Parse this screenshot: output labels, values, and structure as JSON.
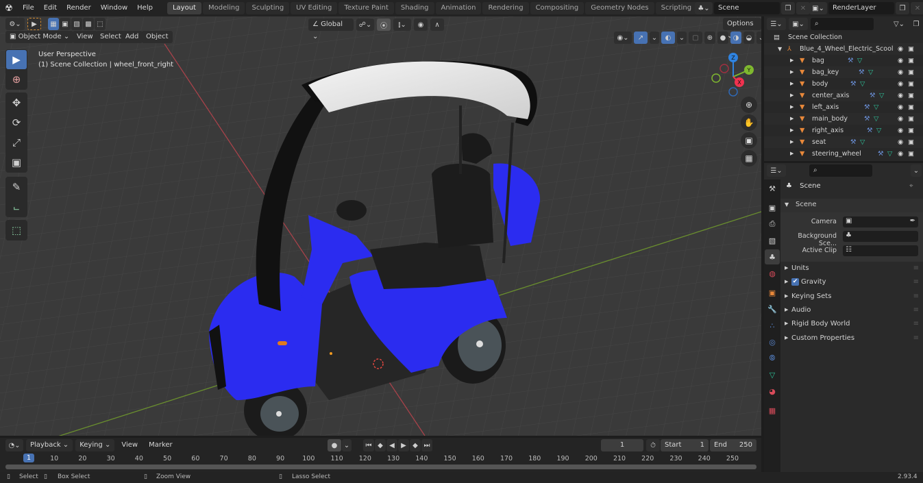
{
  "menubar": {
    "items": [
      "File",
      "Edit",
      "Render",
      "Window",
      "Help"
    ],
    "workspace_tabs": [
      "Layout",
      "Modeling",
      "Sculpting",
      "UV Editing",
      "Texture Paint",
      "Shading",
      "Animation",
      "Rendering",
      "Compositing",
      "Geometry Nodes",
      "Scripting"
    ],
    "active_tab": "Layout",
    "add_tab": "+",
    "scene_name": "Scene",
    "view_layer": "RenderLayer"
  },
  "viewport_header": {
    "mode": "Object Mode",
    "menus": [
      "View",
      "Select",
      "Add",
      "Object"
    ],
    "transform_orientation": "Global",
    "options_label": "Options"
  },
  "viewport": {
    "perspective_label": "User Perspective",
    "context_label": "(1) Scene Collection | wheel_front_right",
    "gizmo_axes": {
      "x": "X",
      "y": "Y",
      "z": "Z"
    },
    "colors": {
      "x_axis": "#f0324f",
      "y_axis": "#7fb82f",
      "z_axis": "#2f83e0",
      "model_blue": "#2b2cf0",
      "active_tool": "#4772b3"
    }
  },
  "outliner": {
    "root": "Scene Collection",
    "collection": "Blue_4_Wheel_Electric_Scool",
    "objects": [
      "bag",
      "bag_key",
      "body",
      "center_axis",
      "left_axis",
      "main_body",
      "right_axis",
      "seat",
      "steering_wheel"
    ]
  },
  "properties": {
    "context_title": "Scene",
    "panel_title": "Scene",
    "fields": [
      {
        "label": "Camera",
        "value": ""
      },
      {
        "label": "Background Sce...",
        "value": ""
      },
      {
        "label": "Active Clip",
        "value": ""
      }
    ],
    "subpanels": [
      {
        "label": "Units",
        "checkbox": false
      },
      {
        "label": "Gravity",
        "checkbox": true,
        "checked": true
      },
      {
        "label": "Keying Sets",
        "checkbox": false
      },
      {
        "label": "Audio",
        "checkbox": false
      },
      {
        "label": "Rigid Body World",
        "checkbox": false
      },
      {
        "label": "Custom Properties",
        "checkbox": false
      }
    ]
  },
  "timeline": {
    "menus": [
      "Playback",
      "Keying",
      "View",
      "Marker"
    ],
    "current_frame": "1",
    "start_label": "Start",
    "start": "1",
    "end_label": "End",
    "end": "250",
    "ticks": [
      "1",
      "10",
      "20",
      "30",
      "40",
      "50",
      "60",
      "70",
      "80",
      "90",
      "100",
      "110",
      "120",
      "130",
      "140",
      "150",
      "160",
      "170",
      "180",
      "190",
      "200",
      "210",
      "220",
      "230",
      "240",
      "250"
    ]
  },
  "statusbar": {
    "hints": [
      "Select",
      "Box Select",
      "Zoom View",
      "Lasso Select"
    ],
    "version": "2.93.4"
  }
}
